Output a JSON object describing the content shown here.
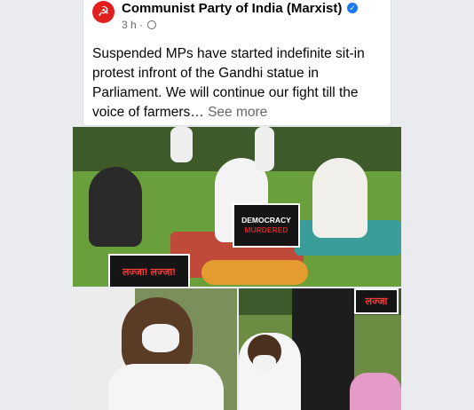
{
  "post": {
    "avatar_symbol": "☭",
    "page_name": "Communist Party of India (Marxist)",
    "verified_icon": "verified-badge-icon",
    "time": "3 h",
    "dot": "·",
    "text": "Suspended MPs have started indefinite sit-in protest infront of the Gandhi statue in Parliament. We will continue our fight till the voice of farmers…",
    "see_more": "See more"
  },
  "photos": {
    "sign_main_line1": "DEMOCRACY",
    "sign_main_line2": "MURDERED",
    "sign_hindi": "लज्जा! लज्जा!",
    "sign_corner": "लज्जा"
  },
  "colors": {
    "brand_red": "#e11f1f",
    "verified_blue": "#1877f2",
    "meta_gray": "#65676b"
  }
}
